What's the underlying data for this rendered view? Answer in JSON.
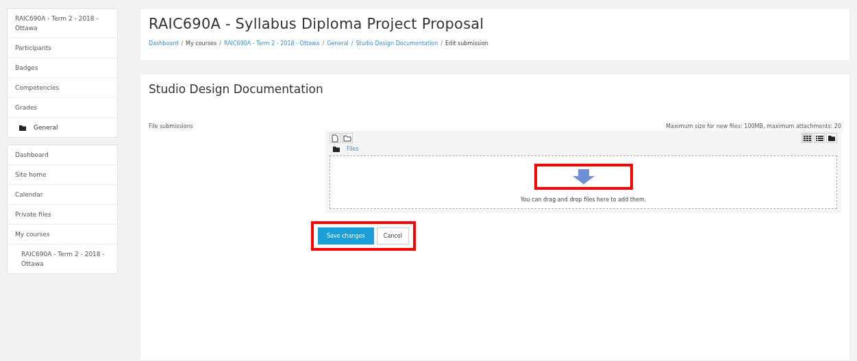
{
  "sidebar": {
    "course_block": [
      {
        "label": "RAIC690A - Term 2 - 2018 - Ottawa",
        "kind": "link"
      },
      {
        "label": "Participants",
        "kind": "link"
      },
      {
        "label": "Badges",
        "kind": "link"
      },
      {
        "label": "Competencies",
        "kind": "link"
      },
      {
        "label": "Grades",
        "kind": "link"
      },
      {
        "label": "General",
        "kind": "folder"
      }
    ],
    "nav_block": [
      {
        "label": "Dashboard"
      },
      {
        "label": "Site home"
      },
      {
        "label": "Calendar"
      },
      {
        "label": "Private files"
      },
      {
        "label": "My courses",
        "children": [
          {
            "label": "RAIC690A - Term 2 - 2018 - Ottawa"
          }
        ]
      }
    ]
  },
  "header": {
    "title": "RAIC690A - Syllabus Diploma Project Proposal",
    "breadcrumb": [
      {
        "label": "Dashboard",
        "kind": "link"
      },
      {
        "label": "/",
        "kind": "separator"
      },
      {
        "label": "My courses",
        "kind": "text"
      },
      {
        "label": "/",
        "kind": "separator"
      },
      {
        "label": "RAIC690A - Term 2 - 2018 - Ottawa",
        "kind": "link"
      },
      {
        "label": "/",
        "kind": "separator"
      },
      {
        "label": "General",
        "kind": "link"
      },
      {
        "label": "/",
        "kind": "separator"
      },
      {
        "label": "Studio Design Documentation",
        "kind": "link"
      },
      {
        "label": "/",
        "kind": "separator"
      },
      {
        "label": "Edit submission",
        "kind": "text"
      }
    ]
  },
  "submission": {
    "heading": "Studio Design Documentation",
    "field_label": "File submissions",
    "limits": "Maximum size for new files: 100MB, maximum attachments: 20",
    "view_modes": [
      {
        "kind": "icons",
        "selected": true
      },
      {
        "kind": "list",
        "selected": false
      },
      {
        "kind": "tree",
        "selected": false
      }
    ],
    "path": "Files",
    "drop_hint": "You can drag and drop files here to add them.",
    "drop_arrow_highlighted": true,
    "buttons": [
      {
        "label": "Save changes",
        "kind": "primary"
      },
      {
        "label": "Cancel",
        "kind": "secondary"
      }
    ],
    "buttons_highlighted": true
  }
}
